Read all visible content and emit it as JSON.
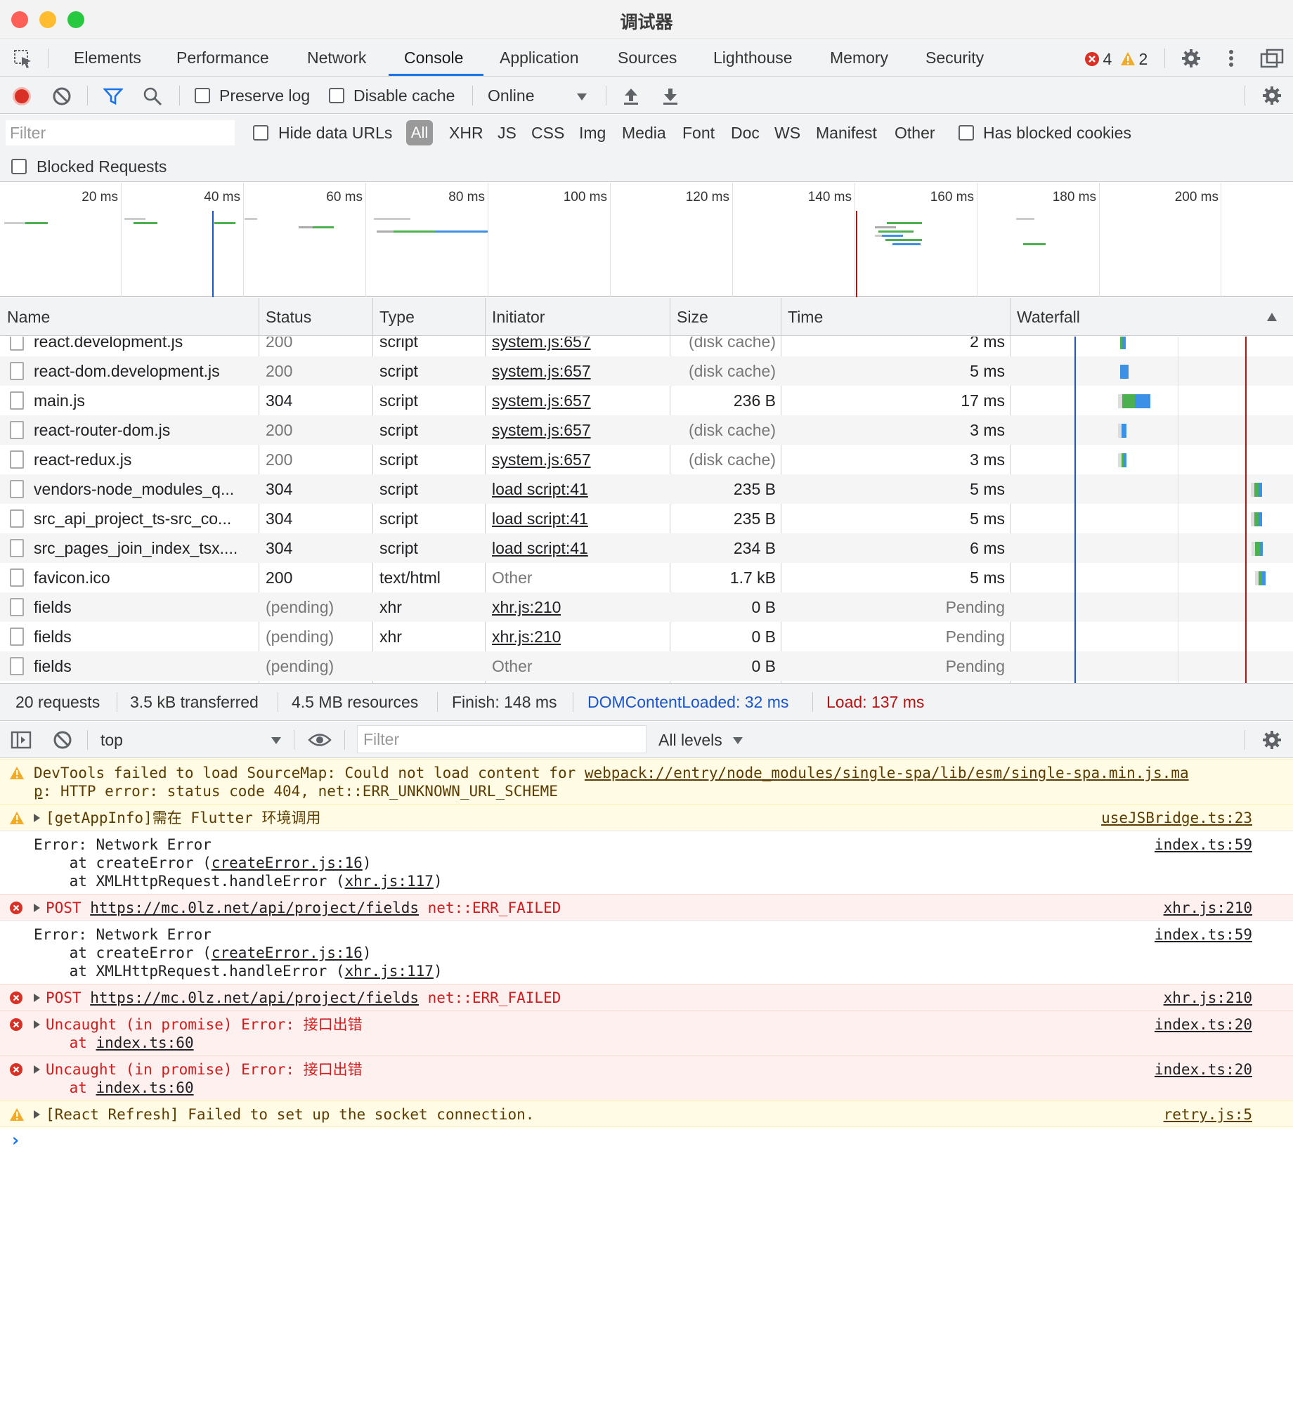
{
  "window": {
    "title": "调试器"
  },
  "tabs": [
    "Elements",
    "Performance",
    "Network",
    "Console",
    "Application",
    "Sources",
    "Lighthouse",
    "Memory",
    "Security"
  ],
  "active_tab": "Console",
  "badges": {
    "errors": "4",
    "warnings": "2"
  },
  "network_toolbar": {
    "preserve_log": "Preserve log",
    "disable_cache": "Disable cache",
    "throttle": "Online"
  },
  "filter_bar": {
    "placeholder": "Filter",
    "hide_data_urls": "Hide data URLs",
    "types": [
      "All",
      "XHR",
      "JS",
      "CSS",
      "Img",
      "Media",
      "Font",
      "Doc",
      "WS",
      "Manifest",
      "Other"
    ],
    "has_blocked_cookies": "Has blocked cookies",
    "blocked_requests": "Blocked Requests"
  },
  "overview": {
    "ticks": [
      "20 ms",
      "40 ms",
      "60 ms",
      "80 ms",
      "100 ms",
      "120 ms",
      "140 ms",
      "160 ms",
      "180 ms",
      "200 ms"
    ]
  },
  "table": {
    "columns": [
      "Name",
      "Status",
      "Type",
      "Initiator",
      "Size",
      "Time",
      "Waterfall"
    ],
    "rows": [
      {
        "name": "react.development.js",
        "status": "200",
        "type": "script",
        "initiator": "system.js:657",
        "size": "(disk cache)",
        "time": "2 ms"
      },
      {
        "name": "react-dom.development.js",
        "status": "200",
        "type": "script",
        "initiator": "system.js:657",
        "size": "(disk cache)",
        "time": "5 ms"
      },
      {
        "name": "main.js",
        "status": "304",
        "type": "script",
        "initiator": "system.js:657",
        "size": "236 B",
        "time": "17 ms"
      },
      {
        "name": "react-router-dom.js",
        "status": "200",
        "type": "script",
        "initiator": "system.js:657",
        "size": "(disk cache)",
        "time": "3 ms"
      },
      {
        "name": "react-redux.js",
        "status": "200",
        "type": "script",
        "initiator": "system.js:657",
        "size": "(disk cache)",
        "time": "3 ms"
      },
      {
        "name": "vendors-node_modules_q...",
        "status": "304",
        "type": "script",
        "initiator": "load script:41",
        "size": "235 B",
        "time": "5 ms"
      },
      {
        "name": "src_api_project_ts-src_co...",
        "status": "304",
        "type": "script",
        "initiator": "load script:41",
        "size": "235 B",
        "time": "5 ms"
      },
      {
        "name": "src_pages_join_index_tsx....",
        "status": "304",
        "type": "script",
        "initiator": "load script:41",
        "size": "234 B",
        "time": "6 ms"
      },
      {
        "name": "favicon.ico",
        "status": "200",
        "type": "text/html",
        "initiator": "Other",
        "size": "1.7 kB",
        "time": "5 ms"
      },
      {
        "name": "fields",
        "status": "(pending)",
        "type": "xhr",
        "initiator": "xhr.js:210",
        "size": "0 B",
        "time": "Pending"
      },
      {
        "name": "fields",
        "status": "(pending)",
        "type": "xhr",
        "initiator": "xhr.js:210",
        "size": "0 B",
        "time": "Pending"
      },
      {
        "name": "fields",
        "status": "(pending)",
        "type": "",
        "initiator": "Other",
        "size": "0 B",
        "time": "Pending"
      }
    ]
  },
  "summary": {
    "requests": "20 requests",
    "transferred": "3.5 kB transferred",
    "resources": "4.5 MB resources",
    "finish": "Finish: 148 ms",
    "domcontentloaded": "DOMContentLoaded: 32 ms",
    "load": "Load: 137 ms"
  },
  "console_toolbar": {
    "context": "top",
    "filter_placeholder": "Filter",
    "levels": "All levels"
  },
  "console": {
    "m1_line1": "DevTools failed to load SourceMap: Could not load content for ",
    "m1_link": "webpack://entry/node_modules/single-spa/lib/esm/single-spa.min.js.ma",
    "m1_line2_link": "p",
    "m1_line2": ": HTTP error: status code 404, net::ERR_UNKNOWN_URL_SCHEME",
    "m2_text": "[getAppInfo]需在 Flutter 环境调用",
    "m2_src": "useJSBridge.ts:23",
    "m3_l1": "Error: Network Error",
    "m3_l2a": "    at createError (",
    "m3_l2link": "createError.js:16",
    "m3_l2b": ")",
    "m3_l3a": "    at XMLHttpRequest.handleError (",
    "m3_l3link": "xhr.js:117",
    "m3_l3b": ")",
    "m3_src": "index.ts:59",
    "m4_a": "POST ",
    "m4_link": "https://mc.0lz.net/api/project/fields",
    "m4_b": " net::ERR_FAILED",
    "m4_src": "xhr.js:210",
    "m5_l1": "Error: Network Error",
    "m5_l2a": "    at createError (",
    "m5_l2link": "createError.js:16",
    "m5_l2b": ")",
    "m5_l3a": "    at XMLHttpRequest.handleError (",
    "m5_l3link": "xhr.js:117",
    "m5_l3b": ")",
    "m5_src": "index.ts:59",
    "m6_a": "POST ",
    "m6_link": "https://mc.0lz.net/api/project/fields",
    "m6_b": " net::ERR_FAILED",
    "m6_src": "xhr.js:210",
    "m7_l1": "Uncaught (in promise) Error: 接口出错",
    "m7_l2a": "    at ",
    "m7_l2link": "index.ts:60",
    "m7_src": "index.ts:20",
    "m8_l1": "Uncaught (in promise) Error: 接口出错",
    "m8_l2a": "    at ",
    "m8_l2link": "index.ts:60",
    "m8_src": "index.ts:20",
    "m9_text": "[React Refresh] Failed to set up the socket connection.",
    "m9_src": "retry.js:5",
    "prompt": "›"
  },
  "colors": {
    "accent": "#1a73e8",
    "error": "#d93025",
    "warning": "#f2ab26",
    "domcontentloaded": "#1a56c9",
    "load": "#b31412"
  }
}
